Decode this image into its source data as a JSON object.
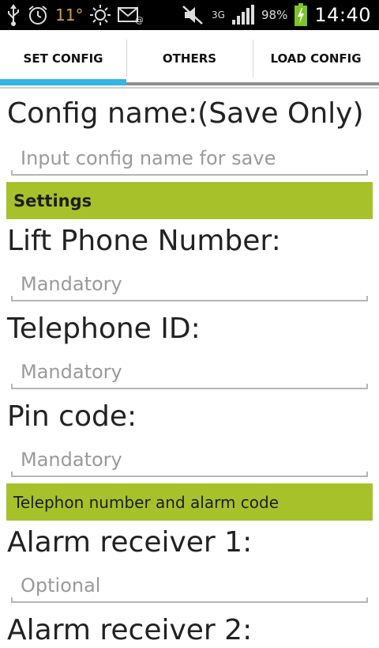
{
  "status_bar": {
    "temperature": "11°",
    "battery_percent": "98%",
    "network": "3G",
    "time": "14:40",
    "icons": [
      "usb-icon",
      "alarm-clock-icon",
      "sun-icon",
      "email-icon",
      "mute-icon",
      "signal-icon",
      "battery-charging-icon"
    ]
  },
  "tabs": [
    {
      "label": "SET CONFIG",
      "selected": true
    },
    {
      "label": "OTHERS",
      "selected": false
    },
    {
      "label": "LOAD CONFIG",
      "selected": false
    }
  ],
  "form": {
    "config_name_label": "Config name:(Save Only)",
    "config_name_placeholder": "Input config name for save",
    "section_settings": "Settings",
    "lift_phone_label": "Lift Phone Number:",
    "lift_phone_placeholder": "Mandatory",
    "telephone_id_label": "Telephone ID:",
    "telephone_id_placeholder": "Mandatory",
    "pin_code_label": "Pin code:",
    "pin_code_placeholder": "Mandatory",
    "section_telephone": "Telephon number and alarm code",
    "alarm1_label": "Alarm receiver 1:",
    "alarm1_placeholder": "Optional",
    "alarm2_label": "Alarm receiver 2:"
  },
  "colors": {
    "tab_indicator": "#33b5e5",
    "section_background": "#a7c12b",
    "status_bar": "#000000"
  }
}
